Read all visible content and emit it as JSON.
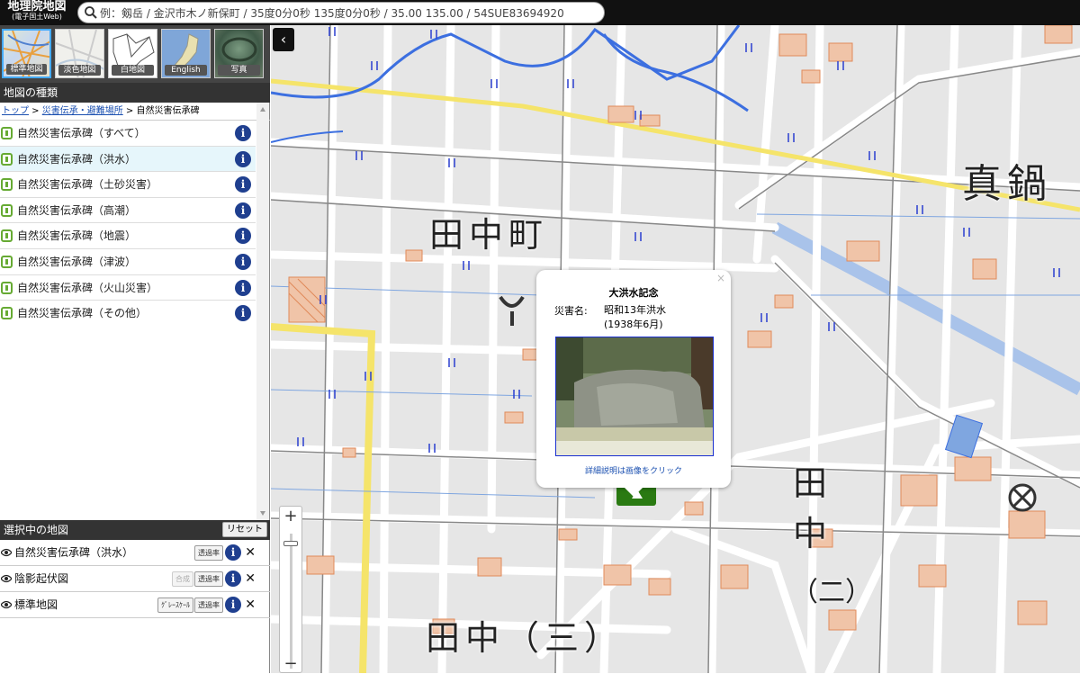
{
  "header": {
    "logo_title": "地理院地図",
    "logo_subtitle": "(電子国土Web)",
    "search_placeholder": "例：剱岳 / 金沢市木ノ新保町 / 35度0分0秒 135度0分0秒 / 35.00 135.00 / 54SUE83694920"
  },
  "basemaps": [
    {
      "label": "標準地図",
      "selected": true
    },
    {
      "label": "淡色地図",
      "selected": false
    },
    {
      "label": "白地図",
      "selected": false
    },
    {
      "label": "English",
      "selected": false
    },
    {
      "label": "写真",
      "selected": false
    }
  ],
  "layers_panel": {
    "title": "地図の種類",
    "breadcrumb": {
      "top": "トップ",
      "sep1": " > ",
      "cat": "災害伝承・避難場所",
      "sep2": " > ",
      "current": "自然災害伝承碑"
    },
    "items": [
      {
        "label": "自然災害伝承碑（すべて）",
        "selected": false
      },
      {
        "label": "自然災害伝承碑（洪水）",
        "selected": true
      },
      {
        "label": "自然災害伝承碑（土砂災害）",
        "selected": false
      },
      {
        "label": "自然災害伝承碑（高潮）",
        "selected": false
      },
      {
        "label": "自然災害伝承碑（地震）",
        "selected": false
      },
      {
        "label": "自然災害伝承碑（津波）",
        "selected": false
      },
      {
        "label": "自然災害伝承碑（火山災害）",
        "selected": false
      },
      {
        "label": "自然災害伝承碑（その他）",
        "selected": false
      }
    ],
    "info_glyph": "i"
  },
  "selected_panel": {
    "title": "選択中の地図",
    "reset_label": "リセット",
    "rows": [
      {
        "label": "自然災害伝承碑（洪水）",
        "buttons": [
          "透過率"
        ]
      },
      {
        "label": "陰影起伏図",
        "buttons": [
          "合成",
          "透過率"
        ]
      },
      {
        "label": "標準地図",
        "buttons": [
          "ｸﾞﾚｰｽｹｰﾙ",
          "透過率"
        ]
      }
    ],
    "remove_glyph": "✕"
  },
  "map": {
    "labels": [
      "田中町",
      "真鍋",
      "田",
      "中",
      "田中（三）",
      "（二）"
    ],
    "collapse_glyph": "‹",
    "zoom_in": "+",
    "zoom_out": "−"
  },
  "popup": {
    "title": "大洪水記念",
    "field_label": "災害名:",
    "field_value_1": "昭和13年洪水",
    "field_value_2": "(1938年6月)",
    "link": "詳細説明は画像をクリック",
    "close_glyph": "×"
  },
  "colors": {
    "road_yellow": "#f5e46a",
    "river_blue": "#3c6fe0",
    "building": "#e39566",
    "canal": "#a9c3ea"
  }
}
